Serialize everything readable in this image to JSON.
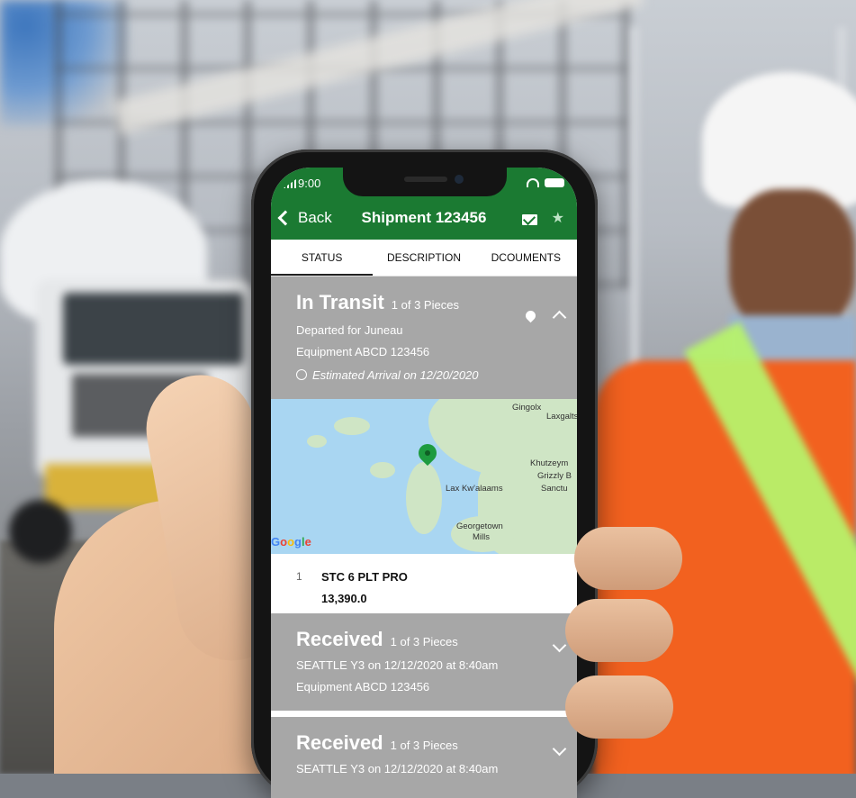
{
  "status_bar": {
    "time": "9:00"
  },
  "nav": {
    "back_label": "Back",
    "title": "Shipment 123456"
  },
  "tabs": [
    {
      "label": "STATUS"
    },
    {
      "label": "DESCRIPTION"
    },
    {
      "label": "DCOUMENTS"
    }
  ],
  "active_tab": "STATUS",
  "shipments": [
    {
      "status": "In Transit",
      "pieces": "1 of 3 Pieces",
      "line1": "Departed for Juneau",
      "line2": "Equipment ABCD 123456",
      "eta": "Estimated Arrival on 12/20/2020"
    },
    {
      "status": "Received",
      "pieces": "1 of 3 Pieces",
      "line1": "SEATTLE Y3 on 12/12/2020 at 8:40am",
      "line2": "Equipment ABCD 123456"
    },
    {
      "status": "Received",
      "pieces": "1 of 3 Pieces",
      "line1": "SEATTLE Y3 on 12/12/2020 at 8:40am"
    }
  ],
  "map": {
    "labels": [
      "Gingolx",
      "Laxgalts",
      "Khutzeym",
      "Grizzly B",
      "Sanctu",
      "Lax Kw'alaams",
      "Georgetown",
      "Mills"
    ],
    "provider": [
      "G",
      "o",
      "o",
      "g",
      "l",
      "e"
    ]
  },
  "line_item": {
    "index": "1",
    "name": "STC 6 PLT PRO",
    "value": "13,390.0"
  },
  "colors": {
    "brand_green": "#1b7a32",
    "card_gray": "#a7a7a7",
    "map_water": "#a9d6f2",
    "map_land": "#cfe5c5"
  }
}
